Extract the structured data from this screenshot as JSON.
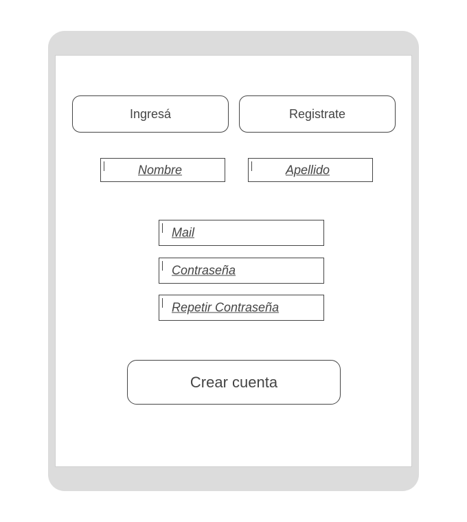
{
  "tabs": {
    "login_label": "Ingresá",
    "register_label": "Registrate"
  },
  "form": {
    "nombre_placeholder": "Nombre",
    "apellido_placeholder": "Apellido",
    "mail_placeholder": "Mail",
    "password_placeholder": "Contraseña",
    "repeat_password_placeholder": "Repetir Contraseña"
  },
  "actions": {
    "create_account_label": "Crear cuenta"
  },
  "colors": {
    "frame": "#dcdcdc",
    "screen": "#ffffff",
    "stroke": "#444444",
    "text": "#444444"
  }
}
